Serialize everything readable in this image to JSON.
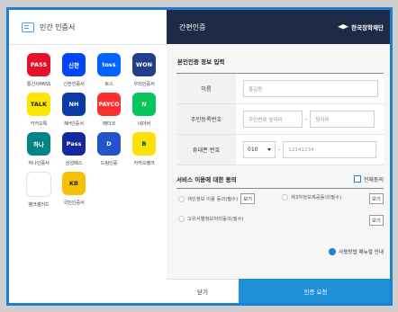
{
  "left": {
    "title": "민간 인증서",
    "apps": [
      {
        "label": "통신사PASS",
        "logo_text": "PASS",
        "logo_color": "#e4112a",
        "icon": "pass-logo"
      },
      {
        "label": "신한인증서",
        "logo_text": "신한",
        "logo_color": "#0046ff",
        "icon": "shinhan-logo"
      },
      {
        "label": "토스",
        "logo_text": "toss",
        "logo_color": "#0064ff",
        "icon": "toss-logo"
      },
      {
        "label": "우리인증서",
        "logo_text": "WON",
        "logo_color": "#1f3f8c",
        "icon": "woori-logo"
      },
      {
        "label": "카카오톡",
        "logo_text": "TALK",
        "logo_color": "#fee500",
        "icon": "kakaotalk-logo"
      },
      {
        "label": "NH인증서",
        "logo_text": "NH",
        "logo_color": "#0a3aa6",
        "icon": "nh-logo"
      },
      {
        "label": "페이코",
        "logo_text": "PAYCO",
        "logo_color": "#ff2d2d",
        "icon": "payco-logo"
      },
      {
        "label": "네이버",
        "logo_text": "N",
        "logo_color": "#03c75a",
        "icon": "naver-logo"
      },
      {
        "label": "하나인증서",
        "logo_text": "하나",
        "logo_color": "#008485",
        "icon": "hana-logo"
      },
      {
        "label": "삼성패스",
        "logo_text": "Pass",
        "logo_color": "#1428a0",
        "icon": "samsungpass-logo"
      },
      {
        "label": "드림인증",
        "logo_text": "D",
        "logo_color": "#2454c8",
        "icon": "dream-logo"
      },
      {
        "label": "카카오뱅크",
        "logo_text": "B",
        "logo_color": "#ffe300",
        "icon": "kakaobank-logo"
      },
      {
        "label": "뱅크샐러드",
        "logo_text": "",
        "logo_color": "#ffffff",
        "icon": "banksalad-logo"
      },
      {
        "label": "국민인증서",
        "logo_text": "KB",
        "logo_color": "#f6c100",
        "icon": "kb-logo"
      }
    ]
  },
  "right": {
    "title": "간편인증",
    "brand": "한국장학재단",
    "section_identity": "본인인증 정보 입력",
    "form": {
      "name_label": "이름",
      "name_placeholder": "홍길동",
      "rrn_label": "주민등록번호",
      "rrn_front_placeholder": "주민번호 앞자리",
      "rrn_back_placeholder": "뒷자리",
      "phone_label": "휴대폰 번호",
      "phone_prefix": "010",
      "phone_placeholder": "12341234"
    },
    "section_agree": "서비스 이용에 대한 동의",
    "agree_all": "전체동의",
    "agreements": [
      {
        "label": "개인정보 이용 동의(필수)",
        "view": "보기"
      },
      {
        "label": "제3자정보제공동의(필수)",
        "view": "보기"
      },
      {
        "label": "고유식별정보처리동의(필수)",
        "view": "보기"
      }
    ],
    "guide": "사용방법 매뉴얼 안내",
    "close_button": "닫기",
    "request_button": "인증 요청"
  }
}
